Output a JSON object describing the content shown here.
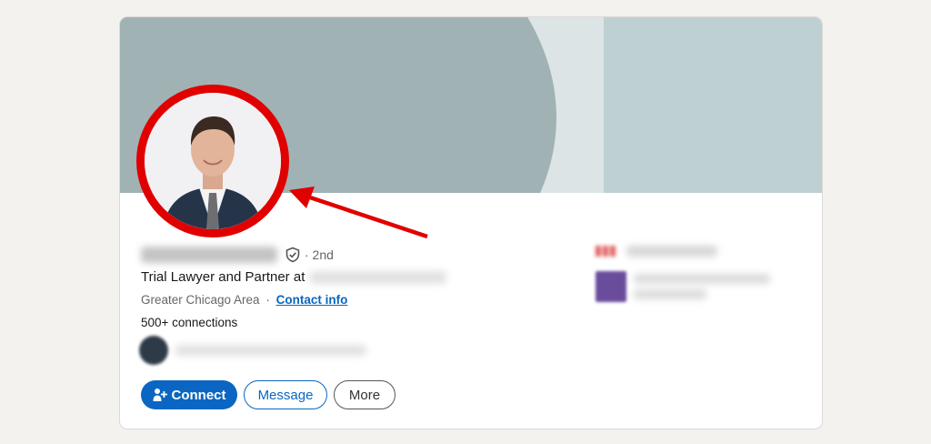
{
  "profile": {
    "verified_icon": "shield-check-icon",
    "degree": "· 2nd",
    "headline": "Trial Lawyer and Partner at",
    "location": "Greater Chicago Area",
    "location_separator": "·",
    "contact_info": "Contact info",
    "connections": "500+ connections"
  },
  "actions": {
    "connect_label": "Connect",
    "connect_icon": "add-person-icon",
    "message_label": "Message",
    "more_label": "More"
  },
  "colors": {
    "annotation_red": "#e00000",
    "primary_blue": "#0a66c2",
    "banner_dark": "#a0b2b4",
    "banner_light": "#dce4e6",
    "banner_right": "#bed0d2"
  },
  "annotation": {
    "type": "red circle and arrow highlighting profile photo"
  }
}
